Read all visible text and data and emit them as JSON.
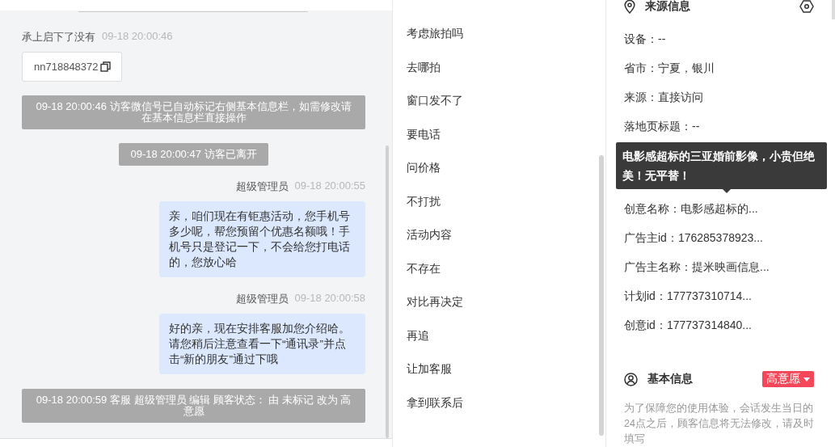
{
  "chat": {
    "messages": [
      {
        "kind": "visitor",
        "sender": "承上启下了没有",
        "time": "09-18 20:00:46",
        "text": "nn718848372"
      },
      {
        "kind": "notice",
        "text": "09-18 20:00:46 访客微信号已自动标记右侧基本信息栏，如需修改请在基本信息栏直接操作"
      },
      {
        "kind": "notice",
        "text": "09-18 20:00:47 访客已离开"
      },
      {
        "kind": "agent",
        "sender": "超级管理员",
        "time": "09-18 20:00:55",
        "text": "亲，咱们现在有钜惠活动，您手机号多少呢，帮您预留个优惠名额哦！手机号只是登记一下，不会给您打电话的，您放心哈"
      },
      {
        "kind": "agent",
        "sender": "超级管理员",
        "time": "09-18 20:00:58",
        "text": "好的亲，现在安排客服加您介绍哈。请您稍后注意查看一下“通讯录”并点击“新的朋友”通过下哦"
      },
      {
        "kind": "notice",
        "text": "09-18 20:00:59 客服 超级管理员 编辑 顾客状态： 由 未标记 改为 高意愿"
      }
    ]
  },
  "phrases": [
    "考虑旅拍吗",
    "去哪拍",
    "窗口发不了",
    "要电话",
    "问价格",
    "不打扰",
    "活动内容",
    "不存在",
    "对比再决定",
    "再追",
    "让加客服",
    "拿到联系后"
  ],
  "source": {
    "title": "来源信息",
    "rows": [
      "设备：--",
      "省市：宁夏，银川",
      "来源：直接访问",
      "落地页标题：--"
    ],
    "tooltip": "电影感超标的三亚婚前影像，小贵但绝美！无平替！",
    "rows_below": [
      "创意名称：电影感超标的...",
      "广告主id：176285378923...",
      "广告主名称：提米映画信息...",
      "计划id：177737310714...",
      "创意id：177737314840..."
    ]
  },
  "basic": {
    "title": "基本信息",
    "status": "高意愿",
    "note": "为了保障您的使用体验，会话发生当日的24点之后，顾客信息将无法修改，请及时填写"
  }
}
